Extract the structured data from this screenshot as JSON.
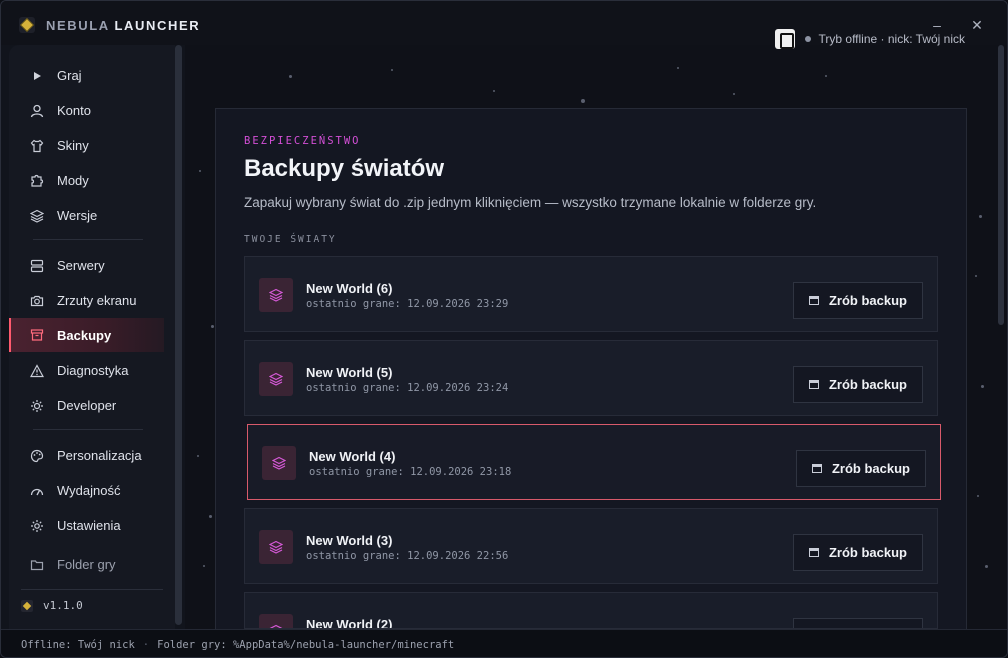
{
  "app": {
    "title_prefix": "NEBULA",
    "title_main": "LAUNCHER",
    "minimize": "–",
    "close": "✕"
  },
  "sidebar": {
    "items": [
      {
        "label": "Graj",
        "icon": "play-icon"
      },
      {
        "label": "Konto",
        "icon": "user-icon"
      },
      {
        "label": "Skiny",
        "icon": "shirt-icon"
      },
      {
        "label": "Mody",
        "icon": "puzzle-icon"
      },
      {
        "label": "Wersje",
        "icon": "layers-icon"
      },
      {
        "label": "Serwery",
        "icon": "server-icon"
      },
      {
        "label": "Zrzuty ekranu",
        "icon": "camera-icon"
      },
      {
        "label": "Backupy",
        "icon": "archive-icon",
        "active": true
      },
      {
        "label": "Diagnostyka",
        "icon": "warning-icon"
      },
      {
        "label": "Developer",
        "icon": "bug-icon"
      },
      {
        "label": "Personalizacja",
        "icon": "palette-icon"
      },
      {
        "label": "Wydajność",
        "icon": "gauge-icon"
      },
      {
        "label": "Ustawienia",
        "icon": "gear-icon"
      },
      {
        "label": "Folder gry",
        "icon": "folder-icon"
      }
    ],
    "version": "v1.1.0"
  },
  "status": {
    "text": "Tryb offline · nick: Twój nick"
  },
  "page": {
    "eyebrow": "BEZPIECZEŃSTWO",
    "title": "Backupy światów",
    "subtitle": "Zapakuj wybrany świat do .zip jednym kliknięciem — wszystko trzymane lokalnie w folderze gry.",
    "section_label": "TWOJE ŚWIATY"
  },
  "worlds": [
    {
      "name": "New World (6)",
      "last_played": "ostatnio grane: 12.09.2026 23:29",
      "button": "Zrób backup"
    },
    {
      "name": "New World (5)",
      "last_played": "ostatnio grane: 12.09.2026 23:24",
      "button": "Zrób backup"
    },
    {
      "name": "New World (4)",
      "last_played": "ostatnio grane: 12.09.2026 23:18",
      "button": "Zrób backup",
      "highlighted": true
    },
    {
      "name": "New World (3)",
      "last_played": "ostatnio grane: 12.09.2026 22:56",
      "button": "Zrób backup"
    },
    {
      "name": "New World (2)",
      "last_played": "",
      "button": ""
    }
  ],
  "footer": {
    "offline": "Offline: Twój nick",
    "separator": "·",
    "folder": "Folder gry: %AppData%/nebula-launcher/minecraft"
  },
  "colors": {
    "accent": "#ff5a6e",
    "eyebrow": "#d34fd6",
    "highlight_border": "#d85a6b"
  }
}
